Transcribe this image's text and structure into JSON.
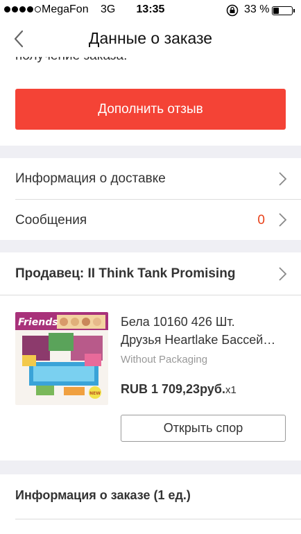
{
  "status_bar": {
    "carrier": "MegaFon",
    "network": "3G",
    "time": "13:35",
    "battery": "33 %"
  },
  "nav": {
    "title": "Данные о заказе"
  },
  "cut_text": "получение заказа.",
  "actions": {
    "add_review": "Дополнить отзыв"
  },
  "menu": {
    "delivery_info": "Информация о доставке",
    "messages": "Сообщения",
    "messages_count": "0"
  },
  "seller": {
    "label": "Продавец: II Think Tank Promising"
  },
  "product": {
    "name_line1": "Бела 10160 426 Шт.",
    "name_line2": "Друзья Heartlake Бассей…",
    "variant": "Without Packaging",
    "price": "RUB 1 709,23руб.",
    "quantity": "x1",
    "open_dispute": "Открыть спор",
    "thumbnail": {
      "brand": "Friends",
      "badge": "NEW"
    }
  },
  "order_info": {
    "label": "Информация о заказе (1 ед.)"
  },
  "colors": {
    "accent": "#f44336",
    "count": "#e8411a",
    "section_gap": "#efeff4"
  }
}
